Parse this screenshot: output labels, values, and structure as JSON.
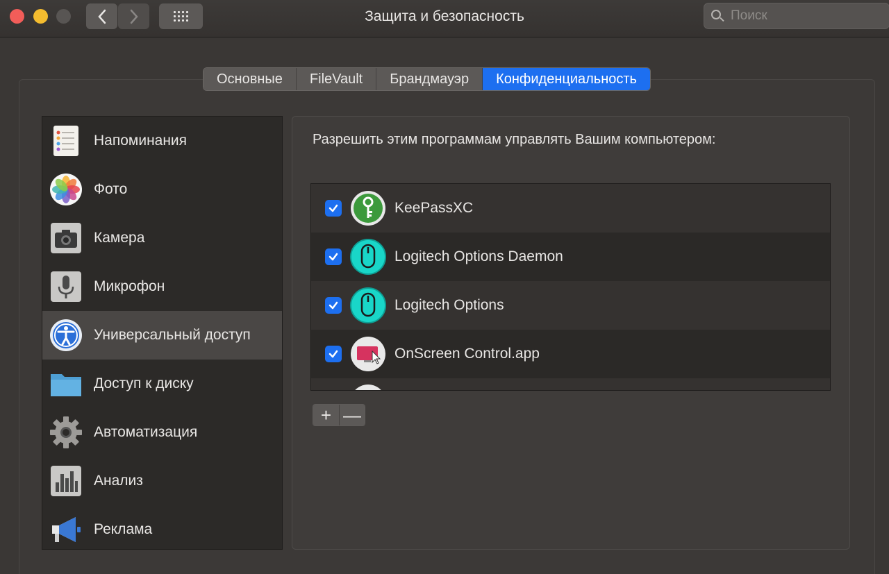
{
  "window": {
    "title": "Защита и безопасность",
    "search_placeholder": "Поиск"
  },
  "tabs": [
    {
      "label": "Основные",
      "active": false
    },
    {
      "label": "FileVault",
      "active": false
    },
    {
      "label": "Брандмауэр",
      "active": false
    },
    {
      "label": "Конфиденциальность",
      "active": true
    }
  ],
  "sidebar": {
    "items": [
      {
        "label": "Напоминания",
        "icon": "reminders-icon"
      },
      {
        "label": "Фото",
        "icon": "photos-icon"
      },
      {
        "label": "Камера",
        "icon": "camera-icon"
      },
      {
        "label": "Микрофон",
        "icon": "microphone-icon"
      },
      {
        "label": "Универсальный доступ",
        "icon": "accessibility-icon",
        "selected": true
      },
      {
        "label": "Доступ к диску",
        "icon": "folder-icon"
      },
      {
        "label": "Автоматизация",
        "icon": "gear-icon"
      },
      {
        "label": "Анализ",
        "icon": "analytics-icon"
      },
      {
        "label": "Реклама",
        "icon": "megaphone-icon"
      }
    ]
  },
  "main": {
    "prompt": "Разрешить этим программам управлять Вашим компьютером:",
    "apps": [
      {
        "name": "KeePassXC",
        "checked": true,
        "icon": "keepassxc-icon"
      },
      {
        "name": "Logitech Options Daemon",
        "checked": true,
        "icon": "logitech-mouse-icon"
      },
      {
        "name": "Logitech Options",
        "checked": true,
        "icon": "logitech-mouse-icon"
      },
      {
        "name": "OnScreen Control.app",
        "checked": true,
        "icon": "onscreen-control-icon"
      }
    ],
    "add_label": "+",
    "remove_label": "—"
  },
  "colors": {
    "accent": "#1d6ff0",
    "close": "#f25d59",
    "minimize": "#f4bc2f",
    "logitech": "#19d6c8",
    "keepass": "#3c9a3c"
  }
}
